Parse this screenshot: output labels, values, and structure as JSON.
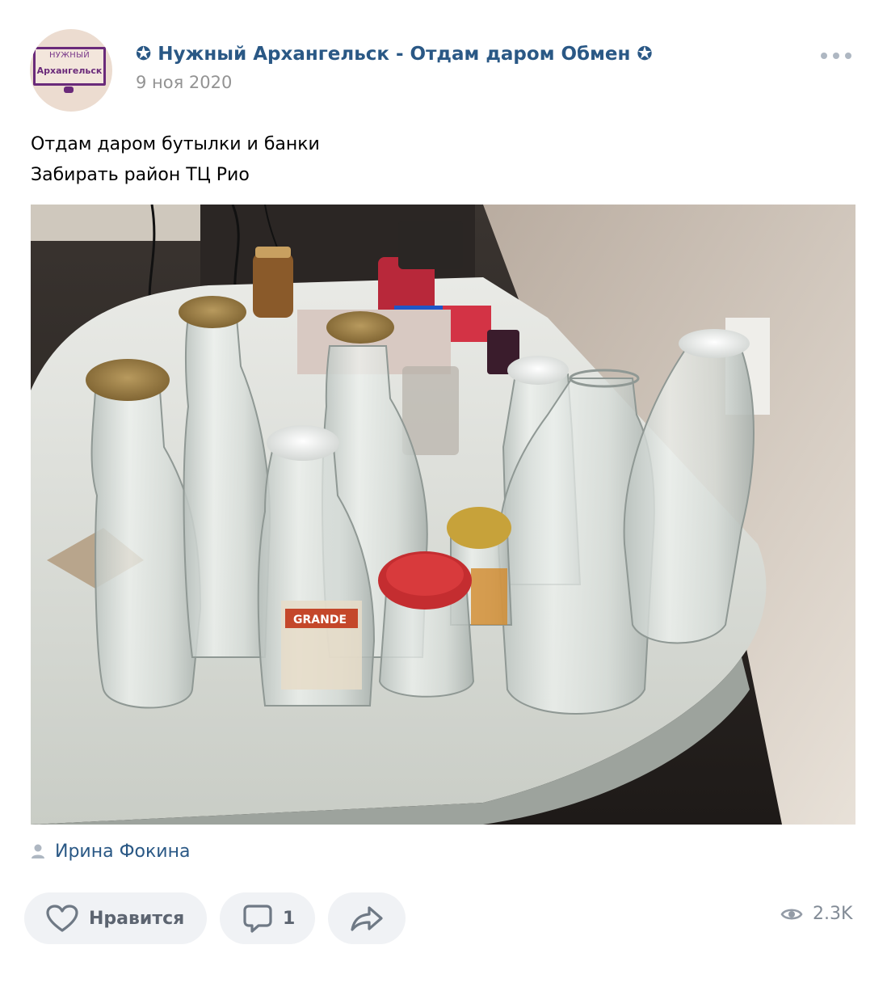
{
  "post": {
    "avatar": {
      "line1": "НУЖНЫЙ",
      "line2": "Архангельск"
    },
    "group_name": "✪ Нужный Архангельск - Отдам даром Обмен ✪",
    "date": "9 ноя 2020",
    "text_lines": [
      "Отдам даром бутылки и банки",
      "Забирать район ТЦ Рио"
    ],
    "photo": {
      "jar_label": "GRANDE"
    },
    "signer": "Ирина Фокина",
    "actions": {
      "like_label": "Нравится",
      "comments_count": "1"
    },
    "views": "2.3K"
  },
  "colors": {
    "link": "#2a5885",
    "meta": "#939393",
    "button_bg": "#f0f2f5",
    "button_text": "#5c6470"
  },
  "icons": [
    "more-icon",
    "user-icon",
    "heart-icon",
    "comment-icon",
    "share-icon",
    "eye-icon"
  ]
}
